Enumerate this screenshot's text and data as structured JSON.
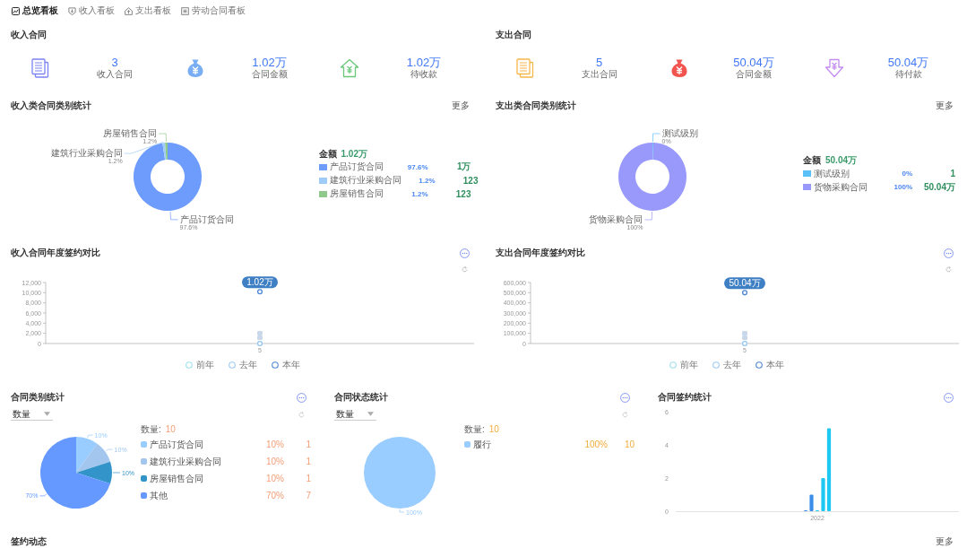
{
  "nav_tabs": [
    {
      "label": "总览看板",
      "selected": true
    },
    {
      "label": "收入看板",
      "selected": false
    },
    {
      "label": "支出看板",
      "selected": false
    },
    {
      "label": "劳动合同看板",
      "selected": false
    }
  ],
  "income": {
    "title": "收入合同",
    "stats": [
      {
        "value": "3",
        "label": "收入合同"
      },
      {
        "value": "1.02万",
        "label": "合同金额"
      },
      {
        "value": "1.02万",
        "label": "待收款"
      }
    ]
  },
  "expense": {
    "title": "支出合同",
    "stats": [
      {
        "value": "5",
        "label": "支出合同"
      },
      {
        "value": "50.04万",
        "label": "合同金额"
      },
      {
        "value": "50.04万",
        "label": "待付款"
      }
    ]
  },
  "income_categories": {
    "title": "收入类合同类别统计",
    "more": "更多",
    "total_label": "金额",
    "total": "1.02万",
    "items": [
      {
        "name": "产品订货合同",
        "percent": "97.6%",
        "amount": "1万",
        "color": "#6e9cfd"
      },
      {
        "name": "建筑行业采购合同",
        "percent": "1.2%",
        "amount": "123",
        "color": "#9fcbf8"
      },
      {
        "name": "房屋销售合同",
        "percent": "1.2%",
        "amount": "123",
        "color": "#8fca8c"
      }
    ],
    "chart_data": {
      "type": "donut",
      "categories": [
        "产品订货合同",
        "建筑行业采购合同",
        "房屋销售合同"
      ],
      "values": [
        97.6,
        1.2,
        1.2
      ],
      "value_labels": [
        "97.6%",
        "1.2%",
        "1.2%"
      ]
    }
  },
  "expense_categories": {
    "title": "支出类合同类别统计",
    "more": "更多",
    "total_label": "金额",
    "total": "50.04万",
    "items": [
      {
        "name": "测试级别",
        "percent": "0%",
        "amount": "1",
        "color": "#5bc0f8"
      },
      {
        "name": "货物采购合同",
        "percent": "100%",
        "amount": "50.04万",
        "color": "#9999fb"
      }
    ],
    "chart_data": {
      "type": "donut",
      "categories": [
        "测试级别",
        "货物采购合同"
      ],
      "values": [
        0.4,
        99.6
      ],
      "value_labels": [
        "0%",
        "100%"
      ]
    }
  },
  "income_yearly": {
    "title": "收入合同年度签约对比",
    "chart_data": {
      "type": "line",
      "categories": [
        "5"
      ],
      "series": [
        {
          "name": "前年",
          "color": "#9ee0ee",
          "marker": "circle",
          "values": [
            0
          ]
        },
        {
          "name": "去年",
          "color": "#9dc8f2",
          "marker": "circle",
          "values": [
            0
          ]
        },
        {
          "name": "本年",
          "color": "#4e86d6",
          "marker": "circle",
          "values": [
            10200
          ]
        }
      ],
      "ylim": [
        0,
        12000
      ],
      "yticks": [
        {
          "value": 0,
          "label": "0"
        },
        {
          "value": 2000,
          "label": "2,000"
        },
        {
          "value": 4000,
          "label": "4,000"
        },
        {
          "value": 6000,
          "label": "6,000"
        },
        {
          "value": 8000,
          "label": "8,000"
        },
        {
          "value": 10000,
          "label": "10,000"
        },
        {
          "value": 12000,
          "label": "12,000"
        }
      ],
      "annotations": [
        {
          "x": "5",
          "y": 10200,
          "text": "1.02万"
        }
      ]
    }
  },
  "expense_yearly": {
    "title": "支出合同年度签约对比",
    "chart_data": {
      "type": "line",
      "categories": [
        "5"
      ],
      "series": [
        {
          "name": "前年",
          "color": "#9ee0ee",
          "marker": "circle",
          "values": [
            0
          ]
        },
        {
          "name": "去年",
          "color": "#9dc8f2",
          "marker": "circle",
          "values": [
            0
          ]
        },
        {
          "name": "本年",
          "color": "#4e86d6",
          "marker": "circle",
          "values": [
            500000
          ]
        }
      ],
      "ylim": [
        0,
        600000
      ],
      "yticks": [
        {
          "value": 0,
          "label": "0"
        },
        {
          "value": 100000,
          "label": "100,000"
        },
        {
          "value": 200000,
          "label": "200,000"
        },
        {
          "value": 300000,
          "label": "300,000"
        },
        {
          "value": 400000,
          "label": "400,000"
        },
        {
          "value": 500000,
          "label": "500,000"
        },
        {
          "value": 600000,
          "label": "600,000"
        }
      ],
      "annotations": [
        {
          "x": "5",
          "y": 500000,
          "text": "50.04万"
        }
      ]
    }
  },
  "category_stats": {
    "title": "合同类别统计",
    "dropdown": "数量",
    "total_label": "数量:",
    "total": "10",
    "items": [
      {
        "percent": "10%",
        "count": "1",
        "color": "#99ccff"
      },
      {
        "percent": "10%",
        "count": "1",
        "color": "#a3c6ee"
      },
      {
        "percent": "10%",
        "count": "1",
        "color": "#3394c9"
      },
      {
        "percent": "70%",
        "count": "7",
        "color": "#6699ff"
      }
    ],
    "chart_data": {
      "type": "pie",
      "categories": [
        "产品订货合同",
        "建筑行业采购合同",
        "房屋销售合同",
        "其他"
      ],
      "values": [
        10,
        10,
        10,
        70
      ],
      "value_labels": [
        "10%",
        "10%",
        "10%",
        "70%"
      ],
      "legend": "right"
    }
  },
  "status_stats": {
    "title": "合同状态统计",
    "dropdown": "数量",
    "total_label": "数量:",
    "total": "10",
    "items": [
      {
        "percent": "100%",
        "count": "10",
        "color": "#99ccff"
      }
    ],
    "chart_data": {
      "type": "pie",
      "categories": [
        "履行"
      ],
      "values": [
        100
      ],
      "value_labels": [
        "100%"
      ],
      "legend": "right"
    }
  },
  "signing_stats": {
    "title": "合同签约统计",
    "chart_data": {
      "type": "bar",
      "categories": [
        "2022"
      ],
      "series": [
        {
          "color": "#3b8de8",
          "values": [
            0
          ]
        },
        {
          "color": "#3b8de8",
          "values": [
            1
          ]
        },
        {
          "color": "#1fc8f2",
          "values": [
            0
          ]
        },
        {
          "color": "#1fc8f2",
          "values": [
            2
          ]
        },
        {
          "color": "#1fc8f2",
          "values": [
            5
          ]
        }
      ],
      "ylim": [
        0,
        6
      ],
      "yticks": [
        {
          "value": 0,
          "label": "0"
        },
        {
          "value": 2,
          "label": "2"
        },
        {
          "value": 4,
          "label": "4"
        },
        {
          "value": 6,
          "label": "6"
        }
      ]
    }
  },
  "signing_activity": {
    "title": "签约动态",
    "more": "更多"
  }
}
